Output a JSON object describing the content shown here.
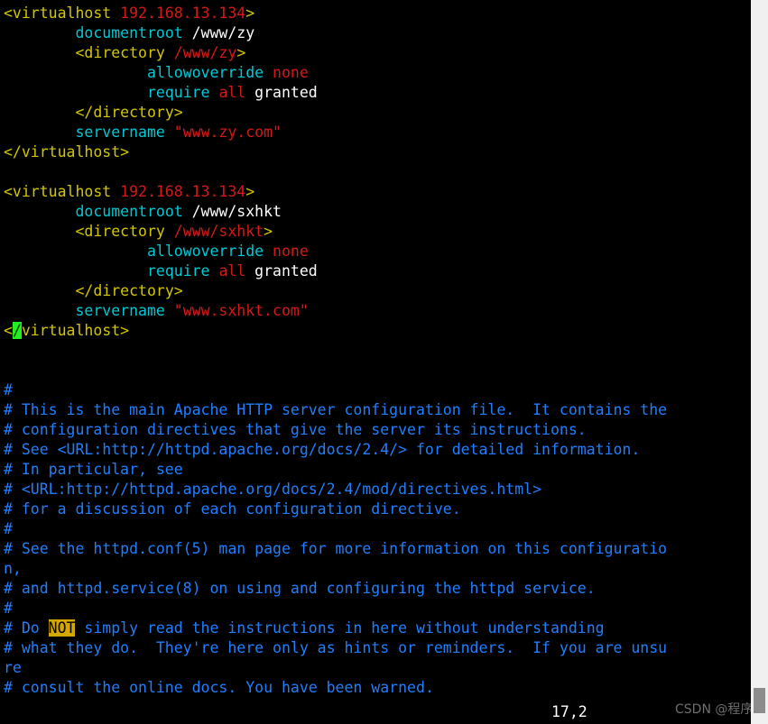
{
  "app": {
    "kind": "terminal-text-editor",
    "colors": {
      "background": "#000000",
      "tag": "#d4c600",
      "ip": "#d41919",
      "directive": "#00c8d4",
      "path": "#ffffff",
      "value": "#d41919",
      "plain": "#ffffff",
      "comment": "#1f7fff",
      "cursor_bg": "#22ee22",
      "highlight_bg": "#d4a800",
      "left_rule": "#1f7fd4",
      "scrollbar_track": "#f0f0f0",
      "scrollbar_thumb": "#8c8c8c"
    }
  },
  "lines": [
    {
      "id": "l1",
      "indent": "",
      "parts": [
        {
          "t": "tag",
          "v": "<virtualhost "
        },
        {
          "t": "ip",
          "v": "192.168.13.134"
        },
        {
          "t": "tag",
          "v": ">"
        }
      ]
    },
    {
      "id": "l2",
      "indent": "        ",
      "parts": [
        {
          "t": "dir",
          "v": "documentroot "
        },
        {
          "t": "path",
          "v": "/www/zy"
        }
      ]
    },
    {
      "id": "l3",
      "indent": "        ",
      "parts": [
        {
          "t": "tag",
          "v": "<directory "
        },
        {
          "t": "val",
          "v": "/www/zy"
        },
        {
          "t": "tag",
          "v": ">"
        }
      ]
    },
    {
      "id": "l4",
      "indent": "                ",
      "parts": [
        {
          "t": "dir",
          "v": "allowoverride "
        },
        {
          "t": "val",
          "v": "none"
        }
      ]
    },
    {
      "id": "l5",
      "indent": "                ",
      "parts": [
        {
          "t": "dir",
          "v": "require "
        },
        {
          "t": "val",
          "v": "all"
        },
        {
          "t": "plain",
          "v": " granted"
        }
      ]
    },
    {
      "id": "l6",
      "indent": "        ",
      "parts": [
        {
          "t": "tag",
          "v": "</directory>"
        }
      ]
    },
    {
      "id": "l7",
      "indent": "        ",
      "parts": [
        {
          "t": "dir",
          "v": "servername "
        },
        {
          "t": "val",
          "v": "\"www.zy.com\""
        }
      ]
    },
    {
      "id": "l8",
      "indent": "",
      "parts": [
        {
          "t": "tag",
          "v": "</virtualhost>"
        }
      ]
    },
    {
      "id": "l9",
      "indent": "",
      "parts": []
    },
    {
      "id": "l10",
      "indent": "",
      "parts": [
        {
          "t": "tag",
          "v": "<virtualhost "
        },
        {
          "t": "ip",
          "v": "192.168.13.134"
        },
        {
          "t": "tag",
          "v": ">"
        }
      ]
    },
    {
      "id": "l11",
      "indent": "        ",
      "parts": [
        {
          "t": "dir",
          "v": "documentroot "
        },
        {
          "t": "path",
          "v": "/www/sxhkt"
        }
      ]
    },
    {
      "id": "l12",
      "indent": "        ",
      "parts": [
        {
          "t": "tag",
          "v": "<directory "
        },
        {
          "t": "val",
          "v": "/www/sxhkt"
        },
        {
          "t": "tag",
          "v": ">"
        }
      ]
    },
    {
      "id": "l13",
      "indent": "                ",
      "parts": [
        {
          "t": "dir",
          "v": "allowoverride "
        },
        {
          "t": "val",
          "v": "none"
        }
      ]
    },
    {
      "id": "l14",
      "indent": "                ",
      "parts": [
        {
          "t": "dir",
          "v": "require "
        },
        {
          "t": "val",
          "v": "all"
        },
        {
          "t": "plain",
          "v": " granted"
        }
      ]
    },
    {
      "id": "l15",
      "indent": "        ",
      "parts": [
        {
          "t": "tag",
          "v": "</directory>"
        }
      ]
    },
    {
      "id": "l16",
      "indent": "        ",
      "parts": [
        {
          "t": "dir",
          "v": "servername "
        },
        {
          "t": "val",
          "v": "\"www.sxhkt.com\""
        }
      ]
    },
    {
      "id": "l17",
      "indent": "",
      "parts": [
        {
          "t": "tag",
          "v": "<"
        },
        {
          "t": "cursor",
          "v": "/"
        },
        {
          "t": "tag",
          "v": "virtualhost>"
        }
      ]
    },
    {
      "id": "l18",
      "indent": "",
      "parts": []
    },
    {
      "id": "l19",
      "indent": "",
      "parts": []
    },
    {
      "id": "l20",
      "indent": "",
      "parts": [
        {
          "t": "comment",
          "v": "#"
        }
      ]
    },
    {
      "id": "l21",
      "indent": "",
      "parts": [
        {
          "t": "comment",
          "v": "# This is the main Apache HTTP server configuration file.  It contains the"
        }
      ]
    },
    {
      "id": "l22",
      "indent": "",
      "parts": [
        {
          "t": "comment",
          "v": "# configuration directives that give the server its instructions."
        }
      ]
    },
    {
      "id": "l23",
      "indent": "",
      "parts": [
        {
          "t": "comment",
          "v": "# See <URL:http://httpd.apache.org/docs/2.4/> for detailed information."
        }
      ]
    },
    {
      "id": "l24",
      "indent": "",
      "parts": [
        {
          "t": "comment",
          "v": "# In particular, see"
        }
      ]
    },
    {
      "id": "l25",
      "indent": "",
      "parts": [
        {
          "t": "comment",
          "v": "# <URL:http://httpd.apache.org/docs/2.4/mod/directives.html>"
        }
      ]
    },
    {
      "id": "l26",
      "indent": "",
      "parts": [
        {
          "t": "comment",
          "v": "# for a discussion of each configuration directive."
        }
      ]
    },
    {
      "id": "l27",
      "indent": "",
      "parts": [
        {
          "t": "comment",
          "v": "#"
        }
      ]
    },
    {
      "id": "l28",
      "indent": "",
      "parts": [
        {
          "t": "comment",
          "v": "# See the httpd.conf(5) man page for more information on this configuratio"
        }
      ]
    },
    {
      "id": "l29",
      "indent": "",
      "parts": [
        {
          "t": "comment",
          "v": "n,"
        }
      ]
    },
    {
      "id": "l30",
      "indent": "",
      "parts": [
        {
          "t": "comment",
          "v": "# and httpd.service(8) on using and configuring the httpd service."
        }
      ]
    },
    {
      "id": "l31",
      "indent": "",
      "parts": [
        {
          "t": "comment",
          "v": "#"
        }
      ]
    },
    {
      "id": "l32",
      "indent": "",
      "parts": [
        {
          "t": "comment",
          "v": "# Do "
        },
        {
          "t": "highlight",
          "v": "NOT"
        },
        {
          "t": "comment",
          "v": " simply read the instructions in here without understanding"
        }
      ]
    },
    {
      "id": "l33",
      "indent": "",
      "parts": [
        {
          "t": "comment",
          "v": "# what they do.  They're here only as hints or reminders.  If you are unsu"
        }
      ]
    },
    {
      "id": "l34",
      "indent": "",
      "parts": [
        {
          "t": "comment",
          "v": "re"
        }
      ]
    },
    {
      "id": "l35",
      "indent": "",
      "parts": [
        {
          "t": "comment",
          "v": "# consult the online docs. You have been warned."
        }
      ]
    }
  ],
  "status": {
    "cursor_position": "17,2"
  },
  "watermark": {
    "text": "CSDN @程序猿顶呱呱"
  }
}
